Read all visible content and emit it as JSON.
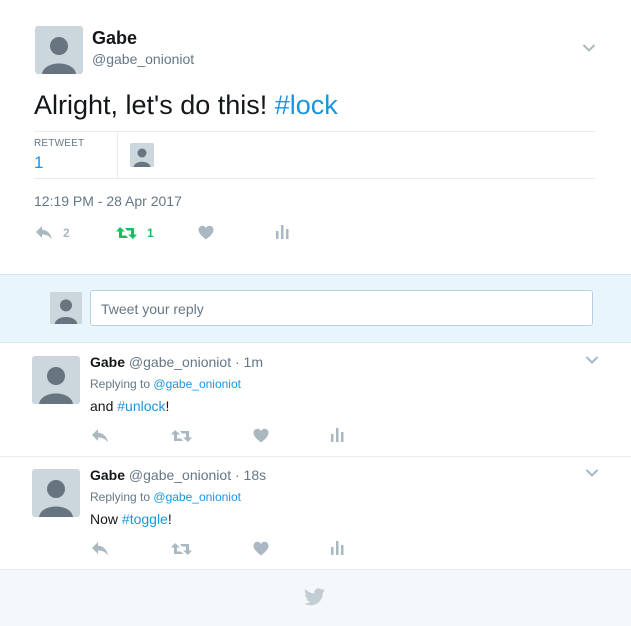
{
  "main_tweet": {
    "name": "Gabe",
    "handle": "@gabe_onioniot",
    "text_prefix": "Alright, let's do this! ",
    "hashtag": "#lock",
    "retweet_label": "RETWEET",
    "retweet_count": "1",
    "timestamp": "12:19 PM - 28 Apr 2017",
    "reply_count": "2",
    "rt_count": "1"
  },
  "reply_box": {
    "placeholder": "Tweet your reply"
  },
  "replies": [
    {
      "name": "Gabe",
      "handle": "@gabe_onioniot",
      "time": "· 1m",
      "replying_label": "Replying to",
      "replying_to": "@gabe_onioniot",
      "text_prefix": "and ",
      "hashtag": "#unlock",
      "text_suffix": "!"
    },
    {
      "name": "Gabe",
      "handle": "@gabe_onioniot",
      "time": "· 18s",
      "replying_label": "Replying to",
      "replying_to": "@gabe_onioniot",
      "text_prefix": "Now ",
      "hashtag": "#toggle",
      "text_suffix": "!"
    }
  ],
  "colors": {
    "link": "#1b95e0",
    "retweet_green": "#17bf63",
    "icon_grey": "#aab8c2",
    "reply_bar": "#e8f5fd"
  },
  "icons": [
    "chevron-down-icon",
    "reply-icon",
    "retweet-icon",
    "heart-icon",
    "analytics-icon",
    "twitter-bird-icon"
  ]
}
